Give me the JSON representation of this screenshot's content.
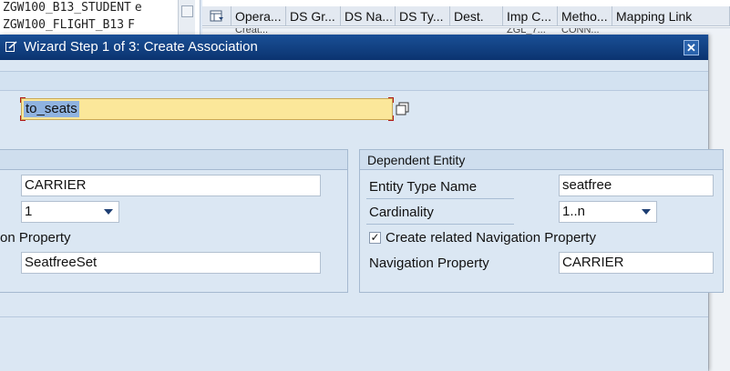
{
  "background": {
    "tree_rows": [
      "ZGW100_B13_STUDENT",
      "ZGW100_FLIGHT_B13"
    ],
    "tree_cut": [
      "e",
      "F"
    ],
    "table_columns": [
      "Opera...",
      "DS Gr...",
      "DS Na...",
      "DS Ty...",
      "Dest.",
      "Imp C...",
      "Metho...",
      "Mapping Link"
    ],
    "table_row_partial": [
      "Creat...",
      "ZGL_7...",
      "CONN..."
    ]
  },
  "dialog": {
    "title": "Wizard Step 1 of 3: Create Association",
    "association_name": "to_seats",
    "principal": {
      "entity_value": "CARRIER",
      "cardinality_value": "1",
      "nav_label_partial": "on Property",
      "nav_value": "SeatfreeSet"
    },
    "dependent": {
      "header": "Dependent Entity",
      "entity_label": "Entity Type Name",
      "entity_value": "seatfree",
      "cardinality_label": "Cardinality",
      "cardinality_value": "1..n",
      "create_nav_label": "Create related Navigation Property",
      "create_nav_checked": true,
      "nav_label": "Navigation Property",
      "nav_value": "CARRIER"
    }
  },
  "colors": {
    "titlebar": "#0b3470",
    "dialog_bg": "#dbe7f3",
    "name_field_bg": "#fbe79a",
    "selection": "#8fb3e0"
  },
  "icons": [
    "dialog-edit-icon",
    "close-icon",
    "copy-icon",
    "layout-icon",
    "dropdown-arrow-icon",
    "checkmark-icon"
  ]
}
